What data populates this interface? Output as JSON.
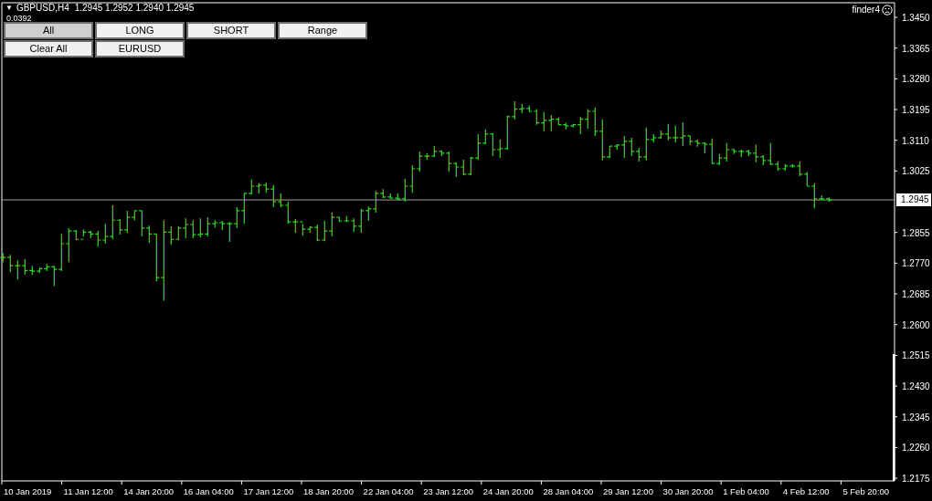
{
  "header": {
    "menu_glyph": "▼",
    "symbol": "GBPUSD,H4",
    "quote": "1.2945 1.2952 1.2940 1.2945",
    "spread": "0.0392"
  },
  "indicator": {
    "name": "finder4"
  },
  "buttons": [
    [
      {
        "label": "All",
        "selected": true
      },
      {
        "label": "LONG",
        "selected": false
      },
      {
        "label": "SHORT",
        "selected": false
      },
      {
        "label": "Range",
        "selected": false
      }
    ],
    [
      {
        "label": "Clear All",
        "selected": false
      },
      {
        "label": "EURUSD",
        "selected": false
      }
    ]
  ],
  "chart": {
    "price_line": {
      "label": "1.2945"
    },
    "price_axis": [
      "1.3450",
      "1.3365",
      "1.3280",
      "1.3195",
      "1.3110",
      "1.3025",
      "1.2855",
      "1.2770",
      "1.2685",
      "1.2600",
      "1.2515",
      "1.2430",
      "1.2345",
      "1.2260",
      "1.2175"
    ],
    "time_axis": [
      "10 Jan 2019",
      "11 Jan 12:00",
      "14 Jan 20:00",
      "16 Jan 04:00",
      "17 Jan 12:00",
      "18 Jan 20:00",
      "22 Jan 04:00",
      "23 Jan 12:00",
      "24 Jan 20:00",
      "28 Jan 04:00",
      "29 Jan 12:00",
      "30 Jan 20:00",
      "1 Feb 04:00",
      "4 Feb 12:00",
      "5 Feb 20:00"
    ]
  }
}
